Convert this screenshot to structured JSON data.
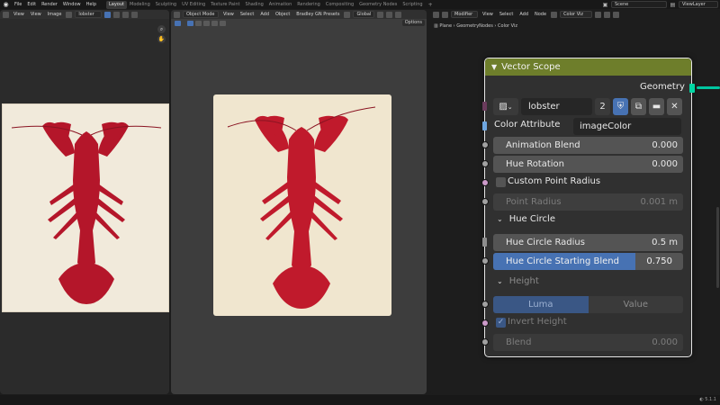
{
  "topbar": {
    "menus": [
      "File",
      "Edit",
      "Render",
      "Window",
      "Help"
    ],
    "workspaces": [
      "Layout",
      "Modeling",
      "Sculpting",
      "UV Editing",
      "Texture Paint",
      "Shading",
      "Animation",
      "Rendering",
      "Compositing",
      "Geometry Nodes",
      "Scripting"
    ],
    "active_workspace": "Layout",
    "scene": "Scene",
    "view_layer": "ViewLayer"
  },
  "image_editor": {
    "view": "View",
    "view2": "View",
    "image": "Image",
    "image_name": "lobster"
  },
  "viewport": {
    "mode": "Object Mode",
    "menus": [
      "View",
      "Select",
      "Add",
      "Object",
      "Bradley GN Presets"
    ],
    "orientation": "Global",
    "options": "Options"
  },
  "node_editor": {
    "editor_type": "Modifier",
    "menus": [
      "View",
      "Select",
      "Add",
      "Node"
    ],
    "node_tree": "Color Viz",
    "breadcrumbs": [
      "Plane",
      "GeometryNodes",
      "Color Viz"
    ]
  },
  "node": {
    "title": "Vector Scope",
    "output": "Geometry",
    "image": {
      "name": "lobster",
      "users": "2"
    },
    "color_attribute": {
      "label": "Color Attribute",
      "value": "imageColor"
    },
    "animation_blend": {
      "label": "Animation Blend",
      "value": "0.000"
    },
    "hue_rotation": {
      "label": "Hue Rotation",
      "value": "0.000"
    },
    "custom_point_radius": {
      "label": "Custom Point Radius",
      "checked": false
    },
    "point_radius": {
      "label": "Point Radius",
      "value": "0.001 m"
    },
    "hue_circle_panel": "Hue Circle",
    "hue_circle_radius": {
      "label": "Hue Circle Radius",
      "value": "0.5 m"
    },
    "hue_circle_starting_blend": {
      "label": "Hue Circle Starting Blend",
      "value": "0.750",
      "fraction": 0.75
    },
    "height_panel": "Height",
    "height_mode": {
      "options": [
        "Luma",
        "Value"
      ],
      "selected": "Luma"
    },
    "invert_height": {
      "label": "Invert Height",
      "checked": true
    },
    "blend": {
      "label": "Blend",
      "value": "0.000"
    }
  },
  "status": {
    "version": "5.1.1"
  },
  "colors": {
    "node_header": "#6e7e2b",
    "accent": "#4772b3",
    "geometry_socket": "#00d6a3"
  }
}
